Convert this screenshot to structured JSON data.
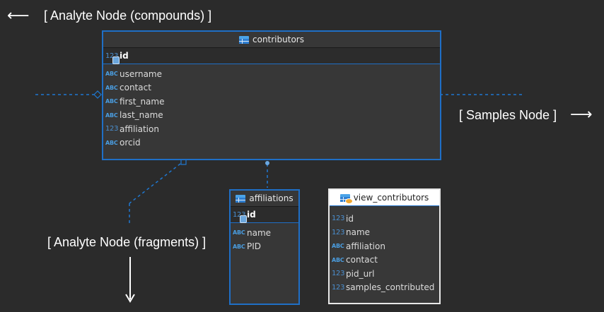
{
  "labels": {
    "analyte_compounds": "[ Analyte Node (compounds) ]",
    "samples": "[ Samples Node ]",
    "analyte_fragments": "[ Analyte Node (fragments) ]"
  },
  "tables": {
    "contributors": {
      "title": "contributors",
      "pk": {
        "type": "123",
        "name": "id"
      },
      "columns": [
        {
          "type": "ABC",
          "name": "username"
        },
        {
          "type": "ABC",
          "name": "contact"
        },
        {
          "type": "ABC",
          "name": "first_name"
        },
        {
          "type": "ABC",
          "name": "last_name"
        },
        {
          "type": "123",
          "name": "affiliation"
        },
        {
          "type": "ABC",
          "name": "orcid"
        }
      ]
    },
    "affiliations": {
      "title": "affiliations",
      "pk": {
        "type": "123",
        "name": "id"
      },
      "columns": [
        {
          "type": "ABC",
          "name": "name"
        },
        {
          "type": "ABC",
          "name": "PID"
        }
      ]
    },
    "view_contributors": {
      "title": "view_contributors",
      "columns": [
        {
          "type": "123",
          "name": "id"
        },
        {
          "type": "123",
          "name": "name"
        },
        {
          "type": "ABC",
          "name": "affiliation"
        },
        {
          "type": "ABC",
          "name": "contact"
        },
        {
          "type": "123",
          "name": "pid_url"
        },
        {
          "type": "123",
          "name": "samples_contributed"
        }
      ]
    }
  },
  "colors": {
    "accent": "#1f6fc6",
    "background": "#2b2b2b",
    "type_icon": "#4a9de0"
  }
}
